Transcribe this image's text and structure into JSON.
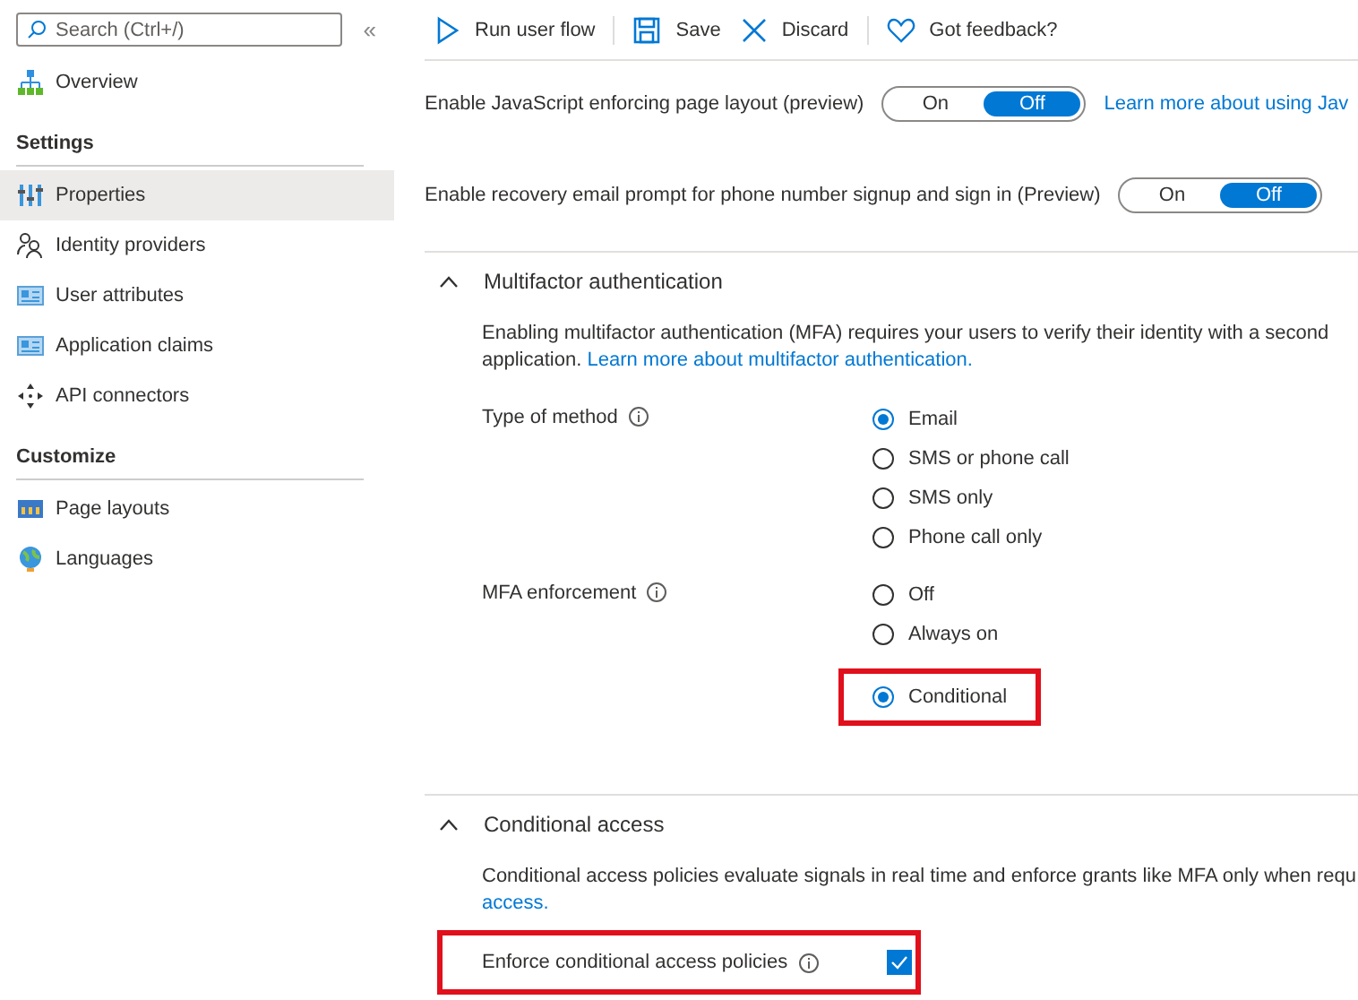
{
  "sidebar": {
    "search": {
      "placeholder": "Search (Ctrl+/)"
    },
    "collapse": "«",
    "groups": [
      {
        "items": [
          {
            "label": "Overview",
            "selected": false
          }
        ]
      },
      {
        "title": "Settings",
        "items": [
          {
            "label": "Properties",
            "selected": true
          },
          {
            "label": "Identity providers",
            "selected": false
          },
          {
            "label": "User attributes",
            "selected": false
          },
          {
            "label": "Application claims",
            "selected": false
          },
          {
            "label": "API connectors",
            "selected": false
          }
        ]
      },
      {
        "title": "Customize",
        "items": [
          {
            "label": "Page layouts",
            "selected": false
          },
          {
            "label": "Languages",
            "selected": false
          }
        ]
      }
    ]
  },
  "toolbar": [
    {
      "label": "Run user flow"
    },
    {
      "label": "Save"
    },
    {
      "label": "Discard"
    },
    {
      "label": "Got feedback?"
    }
  ],
  "toggles": [
    {
      "label": "Enable JavaScript enforcing page layout (preview)",
      "options": [
        {
          "label": "On",
          "selected": false
        },
        {
          "label": "Off",
          "selected": true
        }
      ],
      "link": "Learn more about using Jav"
    },
    {
      "label": "Enable recovery email prompt for phone number signup and sign in (Preview)",
      "options": [
        {
          "label": "On",
          "selected": false
        },
        {
          "label": "Off",
          "selected": true
        }
      ]
    }
  ],
  "sections": [
    {
      "title": "Multifactor authentication",
      "expanded": true,
      "description": [
        {
          "text": "Enabling multifactor authentication (MFA) requires your users to verify their identity with a second",
          "link": false
        },
        {
          "text": "application.",
          "link": false
        },
        {
          "text": "Learn more about multifactor authentication.",
          "link": true
        }
      ],
      "fields": [
        {
          "kind": "radio",
          "label": "Type of method",
          "options": [
            {
              "label": "Email",
              "selected": true,
              "highlighted": false
            },
            {
              "label": "SMS or phone call",
              "selected": false,
              "highlighted": false
            },
            {
              "label": "SMS only",
              "selected": false,
              "highlighted": false
            },
            {
              "label": "Phone call only",
              "selected": false,
              "highlighted": false
            }
          ]
        },
        {
          "kind": "radio",
          "label": "MFA enforcement",
          "options": [
            {
              "label": "Off",
              "selected": false,
              "highlighted": false
            },
            {
              "label": "Always on",
              "selected": false,
              "highlighted": false
            },
            {
              "label": "Conditional",
              "selected": true,
              "highlighted": true
            }
          ]
        }
      ]
    },
    {
      "title": "Conditional access",
      "expanded": true,
      "description": [
        {
          "text": "Conditional access policies evaluate signals in real time and enforce grants like MFA only when requ",
          "link": false
        },
        {
          "text": "access.",
          "link": true
        }
      ],
      "fields": [
        {
          "kind": "checkbox",
          "label": "Enforce conditional access policies",
          "checked": true,
          "highlighted": true
        }
      ]
    }
  ]
}
